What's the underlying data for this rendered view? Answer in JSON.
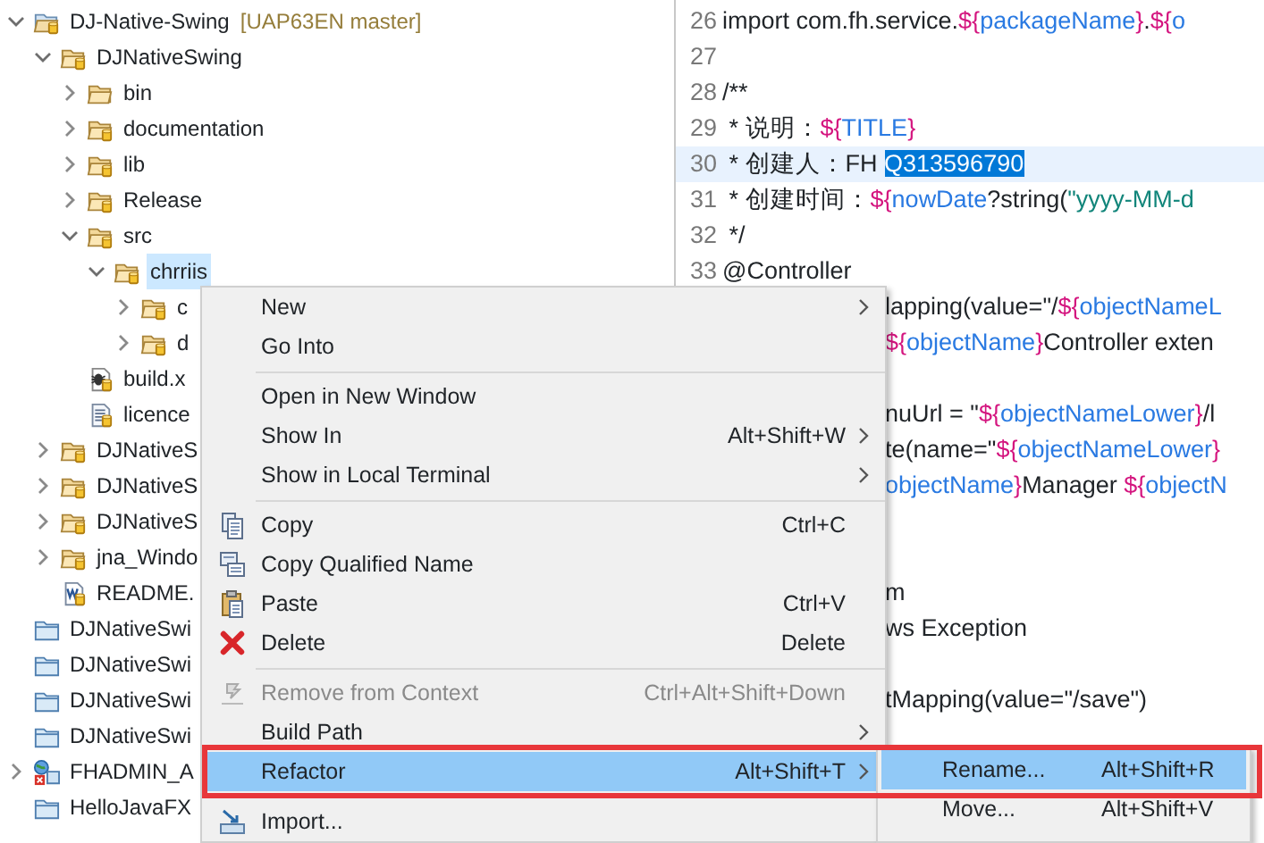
{
  "project_tree": [
    {
      "label": "DJ-Native-Swing",
      "suffix": "[UAP63EN master]",
      "kind": "project",
      "expanded": true,
      "selected": false,
      "children": [
        {
          "label": "DJNativeSwing",
          "kind": "folder",
          "expanded": true,
          "selected": false,
          "children": [
            {
              "label": "bin",
              "kind": "plain-folder",
              "expanded": false,
              "selected": false
            },
            {
              "label": "documentation",
              "kind": "folder",
              "expanded": false,
              "selected": false
            },
            {
              "label": "lib",
              "kind": "folder",
              "expanded": false,
              "selected": false
            },
            {
              "label": "Release",
              "kind": "folder",
              "expanded": false,
              "selected": false
            },
            {
              "label": "src",
              "kind": "folder",
              "expanded": true,
              "selected": false,
              "children": [
                {
                  "label": "chrriis",
                  "kind": "folder",
                  "expanded": true,
                  "selected": true,
                  "children": [
                    {
                      "label": "c",
                      "kind": "folder",
                      "expanded": false,
                      "selected": false
                    },
                    {
                      "label": "d",
                      "kind": "folder",
                      "expanded": false,
                      "selected": false
                    }
                  ]
                }
              ]
            },
            {
              "label": "build.x",
              "kind": "build-file",
              "selected": false
            },
            {
              "label": "licence",
              "kind": "text-file",
              "selected": false
            }
          ]
        },
        {
          "label": "DJNativeS",
          "kind": "folder",
          "expanded": false,
          "selected": false
        },
        {
          "label": "DJNativeS",
          "kind": "folder",
          "expanded": false,
          "selected": false
        },
        {
          "label": "DJNativeS",
          "kind": "folder",
          "expanded": false,
          "selected": false
        },
        {
          "label": "jna_Windo",
          "kind": "folder",
          "expanded": false,
          "selected": false
        },
        {
          "label": "README.",
          "kind": "doc-file",
          "selected": false
        }
      ]
    },
    {
      "label": "DJNativeSwi",
      "kind": "closed-project",
      "selected": false
    },
    {
      "label": "DJNativeSwi",
      "kind": "closed-project",
      "selected": false
    },
    {
      "label": "DJNativeSwi",
      "kind": "closed-project",
      "selected": false
    },
    {
      "label": "DJNativeSwi",
      "kind": "closed-project",
      "selected": false
    },
    {
      "label": "FHADMIN_A",
      "kind": "web-project",
      "expanded": false,
      "selected": false
    },
    {
      "label": "HelloJavaFX",
      "kind": "closed-project",
      "selected": false
    }
  ],
  "editor": {
    "lines": [
      {
        "kind": "line",
        "number": "26",
        "current": false,
        "segments": [
          {
            "t": "import com.fh.service.",
            "kind": "text"
          },
          {
            "t": "${",
            "kind": "delim"
          },
          {
            "t": "packageName",
            "kind": "var"
          },
          {
            "t": "}",
            "kind": "delim"
          },
          {
            "t": ".",
            "kind": "text"
          },
          {
            "t": "${",
            "kind": "delim"
          },
          {
            "t": "o",
            "kind": "var"
          }
        ]
      },
      {
        "kind": "line",
        "number": "27",
        "current": false
      },
      {
        "kind": "line",
        "number": "28",
        "current": false,
        "segments": [
          {
            "t": "/**",
            "kind": "text"
          }
        ]
      },
      {
        "kind": "line",
        "number": "29",
        "current": false,
        "segments": [
          {
            "t": " * 说明：",
            "kind": "text"
          },
          {
            "t": "${",
            "kind": "delim"
          },
          {
            "t": "TITLE",
            "kind": "var"
          },
          {
            "t": "}",
            "kind": "delim"
          }
        ]
      },
      {
        "kind": "line",
        "number": "30",
        "current": true,
        "segments": [
          {
            "t": " * 创建人：FH ",
            "kind": "text"
          },
          {
            "t": "Q313596790",
            "kind": "selection"
          }
        ]
      },
      {
        "kind": "line",
        "number": "31",
        "current": false,
        "segments": [
          {
            "t": " * 创建时间：",
            "kind": "text"
          },
          {
            "t": "${",
            "kind": "delim"
          },
          {
            "t": "nowDate",
            "kind": "var"
          },
          {
            "t": "?string(",
            "kind": "text"
          },
          {
            "t": "\"yyyy-MM-d",
            "kind": "string"
          }
        ]
      },
      {
        "kind": "line",
        "number": "32",
        "current": false,
        "segments": [
          {
            "t": " */",
            "kind": "text"
          }
        ]
      },
      {
        "kind": "line",
        "number": "33",
        "current": false,
        "segments": [
          {
            "t": "@Controller",
            "kind": "text"
          }
        ]
      },
      {
        "kind": "fragment",
        "segments": [
          {
            "t": "lapping(value=\"/",
            "kind": "text"
          },
          {
            "t": "${",
            "kind": "delim"
          },
          {
            "t": "objectNameL",
            "kind": "var"
          }
        ]
      },
      {
        "kind": "fragment",
        "segments": [
          {
            "t": "${",
            "kind": "delim"
          },
          {
            "t": "objectName",
            "kind": "var"
          },
          {
            "t": "}",
            "kind": "delim"
          },
          {
            "t": "Controller exten",
            "kind": "text"
          }
        ]
      },
      {
        "kind": "fragment"
      },
      {
        "kind": "fragment",
        "segments": [
          {
            "t": "nuUrl = \"",
            "kind": "text"
          },
          {
            "t": "${",
            "kind": "delim"
          },
          {
            "t": "objectNameLower",
            "kind": "var"
          },
          {
            "t": "}",
            "kind": "delim"
          },
          {
            "t": "/l",
            "kind": "text"
          }
        ]
      },
      {
        "kind": "fragment",
        "segments": [
          {
            "t": "te(name=\"",
            "kind": "text"
          },
          {
            "t": "${",
            "kind": "delim"
          },
          {
            "t": "objectNameLower",
            "kind": "var"
          },
          {
            "t": "}",
            "kind": "delim"
          }
        ]
      },
      {
        "kind": "fragment",
        "segments": [
          {
            "t": "objectName",
            "kind": "var"
          },
          {
            "t": "}",
            "kind": "delim"
          },
          {
            "t": "Manager ",
            "kind": "text"
          },
          {
            "t": "${",
            "kind": "delim"
          },
          {
            "t": "objectN",
            "kind": "var"
          }
        ]
      },
      {
        "kind": "fragment"
      },
      {
        "kind": "fragment"
      },
      {
        "kind": "fragment",
        "segments": [
          {
            "t": "m",
            "kind": "text"
          }
        ]
      },
      {
        "kind": "fragment",
        "segments": [
          {
            "t": "ws Exception",
            "kind": "text"
          }
        ]
      },
      {
        "kind": "fragment"
      },
      {
        "kind": "fragment",
        "segments": [
          {
            "t": "tMapping(value=\"/save\")",
            "kind": "text"
          }
        ]
      }
    ]
  },
  "context_menu": {
    "items": [
      {
        "kind": "item",
        "label": "New",
        "submenu": true,
        "disabled": false,
        "selected": false,
        "annotated": false
      },
      {
        "kind": "item",
        "label": "Go Into",
        "submenu": false,
        "disabled": false,
        "selected": false,
        "annotated": false
      },
      {
        "kind": "separator"
      },
      {
        "kind": "item",
        "label": "Open in New Window",
        "submenu": false,
        "disabled": false,
        "selected": false,
        "annotated": false
      },
      {
        "kind": "item",
        "label": "Show In",
        "shortcut": "Alt+Shift+W",
        "submenu": true,
        "disabled": false,
        "selected": false,
        "annotated": false
      },
      {
        "kind": "item",
        "label": "Show in Local Terminal",
        "submenu": true,
        "disabled": false,
        "selected": false,
        "annotated": false
      },
      {
        "kind": "separator"
      },
      {
        "kind": "copy",
        "label": "Copy",
        "shortcut": "Ctrl+C",
        "submenu": false,
        "disabled": false,
        "selected": false,
        "annotated": false
      },
      {
        "kind": "copy-name",
        "label": "Copy Qualified Name",
        "submenu": false,
        "disabled": false,
        "selected": false,
        "annotated": false
      },
      {
        "kind": "paste",
        "label": "Paste",
        "shortcut": "Ctrl+V",
        "submenu": false,
        "disabled": false,
        "selected": false,
        "annotated": false
      },
      {
        "kind": "delete",
        "label": "Delete",
        "shortcut": "Delete",
        "submenu": false,
        "disabled": false,
        "selected": false,
        "annotated": false
      },
      {
        "kind": "separator"
      },
      {
        "kind": "remove",
        "label": "Remove from Context",
        "shortcut": "Ctrl+Alt+Shift+Down",
        "submenu": false,
        "disabled": true,
        "selected": false,
        "annotated": false
      },
      {
        "kind": "item",
        "label": "Build Path",
        "submenu": true,
        "disabled": false,
        "selected": false,
        "annotated": false
      },
      {
        "kind": "item",
        "label": "Refactor",
        "shortcut": "Alt+Shift+T",
        "submenu": true,
        "disabled": false,
        "selected": true,
        "annotated": true
      },
      {
        "kind": "separator"
      },
      {
        "kind": "import",
        "label": "Import...",
        "submenu": false,
        "disabled": false,
        "selected": false,
        "annotated": false
      }
    ]
  },
  "submenu": {
    "items": [
      {
        "label": "Rename...",
        "shortcut": "Alt+Shift+R",
        "selected": true
      },
      {
        "label": "Move...",
        "shortcut": "Alt+Shift+V",
        "selected": false
      }
    ]
  }
}
